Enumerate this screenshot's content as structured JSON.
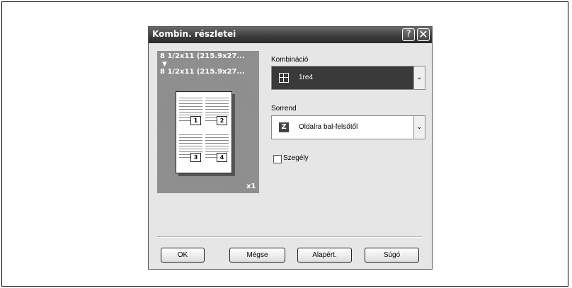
{
  "dialog": {
    "title": "Kombin. részletei",
    "help_button": "?",
    "close_button": "✕"
  },
  "preview": {
    "paper_from": "8 1/2x11 (215.9x27...",
    "arrow": "▼",
    "paper_to": "8 1/2x11 (215.9x27...",
    "page_numbers": [
      "1",
      "2",
      "3",
      "4"
    ],
    "copies": "x1"
  },
  "combination": {
    "label": "Kombináció",
    "value": "1re4"
  },
  "order": {
    "label": "Sorrend",
    "value": "Oldalra bal-felsőtől"
  },
  "border": {
    "label": "Szegély",
    "checked": false
  },
  "buttons": {
    "ok": "OK",
    "cancel": "Mégse",
    "defaults": "Alapért.",
    "help": "Súgó"
  },
  "colors": {
    "titlebar": "#3a3a3a",
    "dialog_bg": "#e6e6e6",
    "preview_bg": "#8c8c8c"
  }
}
